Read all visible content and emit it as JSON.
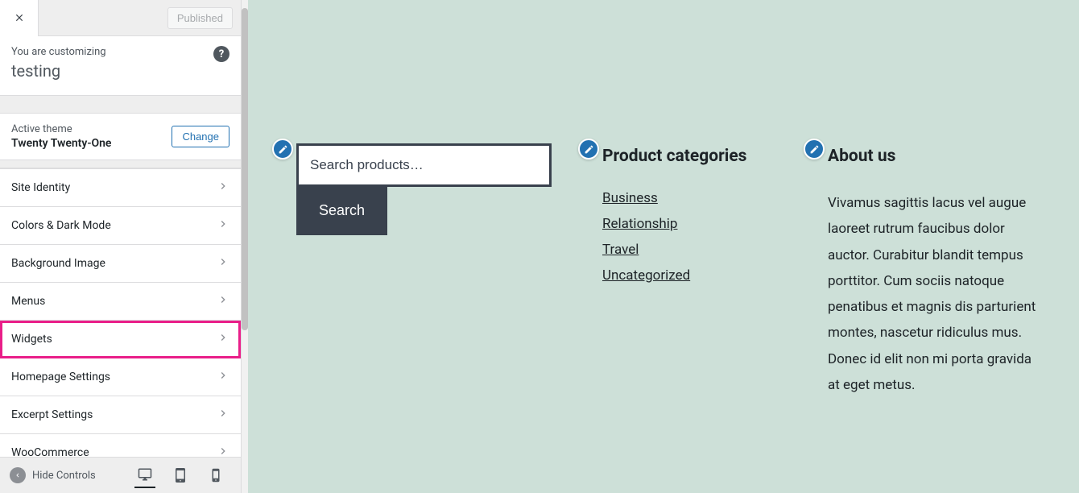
{
  "topbar": {
    "publish_label": "Published"
  },
  "info": {
    "customizing_label": "You are customizing",
    "site_name": "testing",
    "help_glyph": "?"
  },
  "theme": {
    "label": "Active theme",
    "name": "Twenty Twenty-One",
    "change_label": "Change"
  },
  "menu": {
    "items": [
      {
        "label": "Site Identity",
        "highlighted": false
      },
      {
        "label": "Colors & Dark Mode",
        "highlighted": false
      },
      {
        "label": "Background Image",
        "highlighted": false
      },
      {
        "label": "Menus",
        "highlighted": false
      },
      {
        "label": "Widgets",
        "highlighted": true
      },
      {
        "label": "Homepage Settings",
        "highlighted": false
      },
      {
        "label": "Excerpt Settings",
        "highlighted": false
      },
      {
        "label": "WooCommerce",
        "highlighted": false
      }
    ]
  },
  "bottombar": {
    "hide_label": "Hide Controls"
  },
  "preview": {
    "search": {
      "placeholder": "Search products…",
      "button_label": "Search"
    },
    "categories": {
      "title": "Product categories",
      "items": [
        "Business",
        "Relationship",
        "Travel",
        "Uncategorized"
      ]
    },
    "about": {
      "title": "About us",
      "text": "Vivamus sagittis lacus vel augue laoreet rutrum faucibus dolor auctor. Curabitur blandit tempus porttitor. Cum sociis natoque penatibus et magnis dis parturient montes, nascetur ridiculus mus. Donec id elit non mi porta gravida at eget metus."
    }
  }
}
